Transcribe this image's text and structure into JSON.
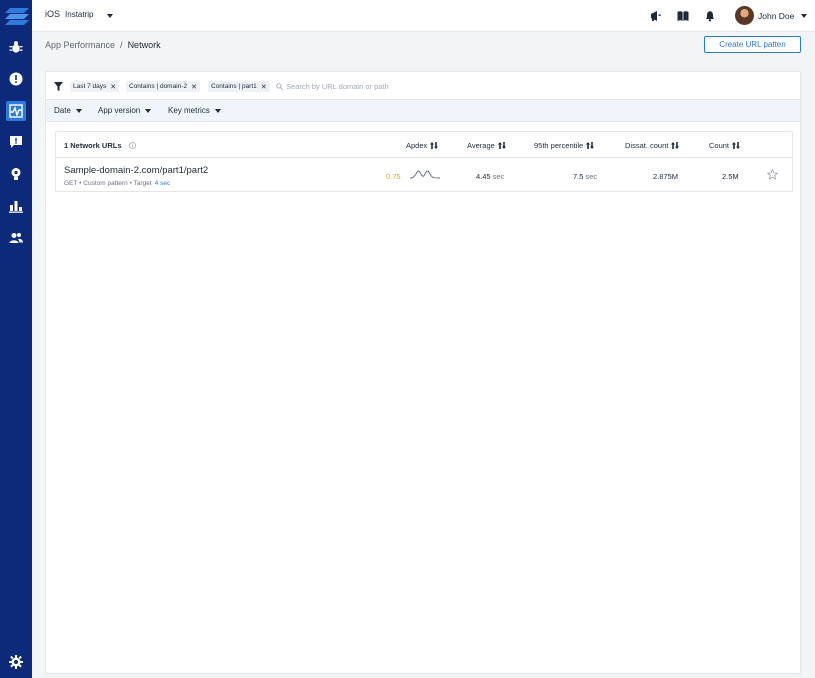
{
  "colors": {
    "sidebar": "#0d2a7a",
    "active_item": "#2f7bdc",
    "accent": "#2d7ad6",
    "apdex_warning": "#f0a61b"
  },
  "sidebar": {
    "items": [
      {
        "icon": "bug-icon",
        "active": false
      },
      {
        "icon": "alert-icon",
        "active": false
      },
      {
        "icon": "app-performance-icon",
        "active": true
      },
      {
        "icon": "feedback-icon",
        "active": false
      },
      {
        "icon": "feature-request-icon",
        "active": false
      },
      {
        "icon": "analytics-icon",
        "active": false
      },
      {
        "icon": "team-icon",
        "active": false
      }
    ],
    "bottom_icon": "settings-icon"
  },
  "topbar": {
    "platform": "iOS",
    "app_name": "Instatrip",
    "icons": [
      "announcements-icon",
      "docs-icon",
      "notifications-icon"
    ],
    "user_name": "John Doe"
  },
  "breadcrumb": {
    "parent": "App Performance",
    "separator": "/",
    "current": "Network"
  },
  "create_button": "Create URL patten",
  "filters": {
    "chips": [
      "Last 7 days",
      "Contains | domain-2",
      "Contains | part1"
    ],
    "search_placeholder": "Search by URL domain or path"
  },
  "dropdowns": [
    "Date",
    "App version",
    "Key metrics"
  ],
  "table": {
    "title": "1 Network URLs",
    "columns": [
      "Apdex",
      "Average",
      "95th percentile",
      "Dissat. count",
      "Count"
    ],
    "rows": [
      {
        "url": "Sample-domain-2.com/part1/part2",
        "method": "GET",
        "pattern": "Custom pattern",
        "target_label": "Target",
        "target_value": "4 sec",
        "apdex": "0.75",
        "average_value": "4.45",
        "average_unit": "sec",
        "p95_value": "7.5",
        "p95_unit": "sec",
        "dissat_count": "2.875M",
        "count": "2.5M"
      }
    ]
  }
}
